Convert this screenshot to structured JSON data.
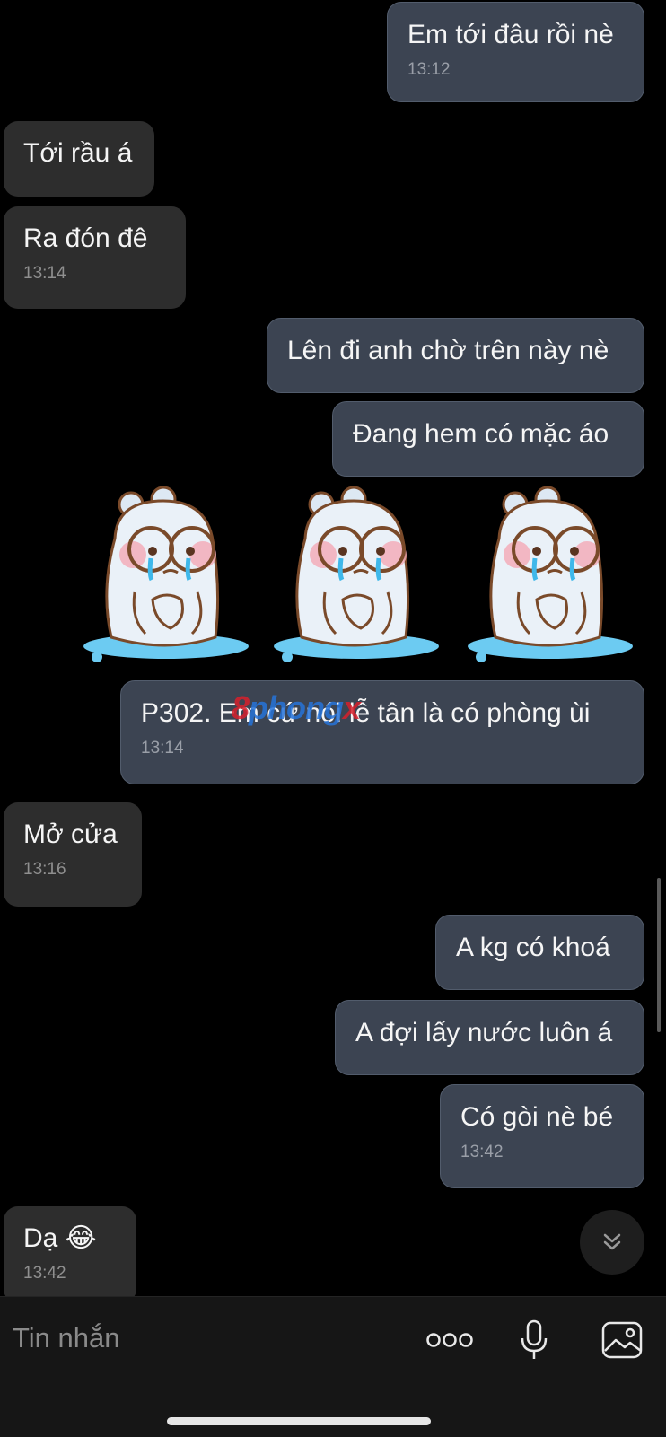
{
  "messages": [
    {
      "id": "m1",
      "side": "sent",
      "text": "Em tới đâu rồi nè",
      "time": "13:12"
    },
    {
      "id": "m2",
      "side": "recv",
      "text": "Tới rầu á",
      "time": ""
    },
    {
      "id": "m3",
      "side": "recv",
      "text": "Ra đón đê",
      "time": "13:14"
    },
    {
      "id": "m4",
      "side": "sent",
      "text": "Lên đi anh chờ trên này nè",
      "time": ""
    },
    {
      "id": "m5",
      "side": "sent",
      "text": "Đang hem có mặc áo",
      "time": ""
    },
    {
      "id": "m6",
      "side": "sent",
      "text": "P302. Em cứ nói lễ tân là có phòng ùi",
      "time": "13:14"
    },
    {
      "id": "m7",
      "side": "recv",
      "text": "Mở cửa",
      "time": "13:16"
    },
    {
      "id": "m8",
      "side": "sent",
      "text": "A kg có khoá",
      "time": ""
    },
    {
      "id": "m9",
      "side": "sent",
      "text": "A đợi lấy nước luôn á",
      "time": ""
    },
    {
      "id": "m10",
      "side": "sent",
      "text": "Có gòi nè bé",
      "time": "13:42"
    },
    {
      "id": "m11",
      "side": "recv",
      "text": "Dạ 😂",
      "time": "13:42"
    }
  ],
  "stickers": {
    "name": "crying-bear-sticker",
    "count": 3
  },
  "watermark": {
    "part1": "8",
    "part2": "phong",
    "part3": "x"
  },
  "composer": {
    "placeholder": "Tin nhắn",
    "more_icon": "more-dots-icon",
    "mic_icon": "microphone-icon",
    "image_icon": "image-icon"
  },
  "scroll_down_icon": "double-chevron-down-icon",
  "colors": {
    "background": "#000000",
    "sent_bubble": "#3c4452",
    "received_bubble": "#2d2d2d",
    "timestamp": "#9a9fa8"
  }
}
